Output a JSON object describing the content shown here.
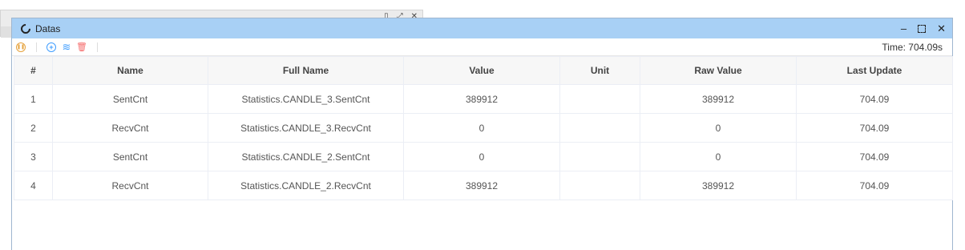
{
  "window": {
    "title": "Datas",
    "minimize": "–",
    "close": "✕"
  },
  "toolbar": {
    "time_label": "Time: 704.09s"
  },
  "table": {
    "headers": [
      "#",
      "Name",
      "Full Name",
      "Value",
      "Unit",
      "Raw Value",
      "Last Update"
    ],
    "rows": [
      {
        "index": "1",
        "name": "SentCnt",
        "full_name": "Statistics.CANDLE_3.SentCnt",
        "value": "389912",
        "unit": "",
        "raw_value": "389912",
        "last_update": "704.09"
      },
      {
        "index": "2",
        "name": "RecvCnt",
        "full_name": "Statistics.CANDLE_3.RecvCnt",
        "value": "0",
        "unit": "",
        "raw_value": "0",
        "last_update": "704.09"
      },
      {
        "index": "3",
        "name": "SentCnt",
        "full_name": "Statistics.CANDLE_2.SentCnt",
        "value": "0",
        "unit": "",
        "raw_value": "0",
        "last_update": "704.09"
      },
      {
        "index": "4",
        "name": "RecvCnt",
        "full_name": "Statistics.CANDLE_2.RecvCnt",
        "value": "389912",
        "unit": "",
        "raw_value": "389912",
        "last_update": "704.09"
      }
    ]
  },
  "icons": {
    "pause": "pause-icon",
    "add": "add-icon",
    "wave": "wave-icon",
    "delete": "delete-icon"
  },
  "colors": {
    "titlebar": "#a8d0f5",
    "accent": "#409eff",
    "warning": "#e6a23c",
    "danger": "#f56c6c"
  }
}
